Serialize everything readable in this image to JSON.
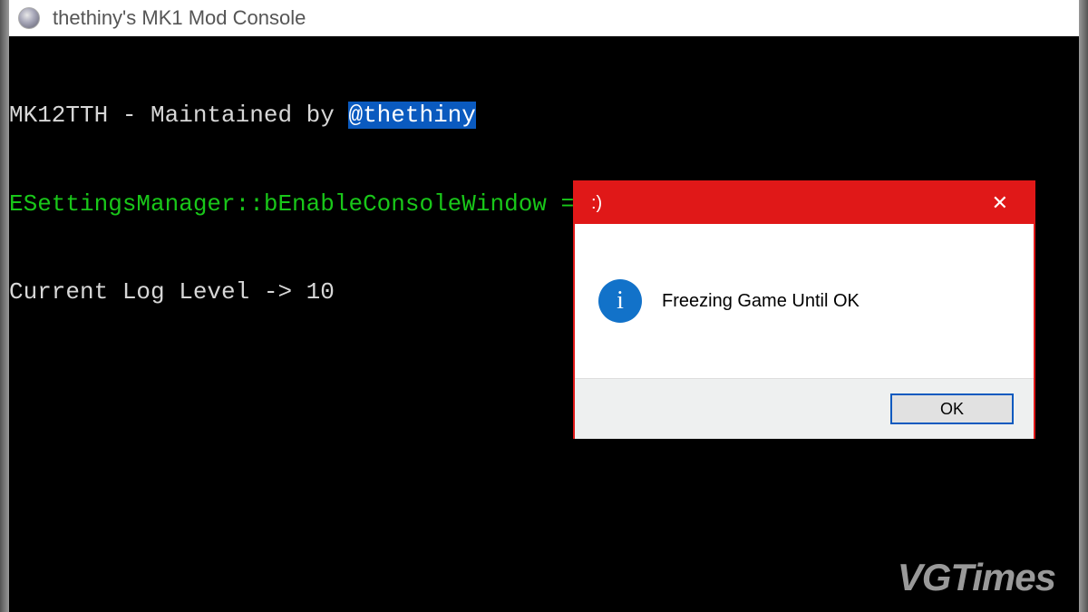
{
  "window": {
    "title": "thethiny's MK1 Mod Console"
  },
  "console": {
    "line1_prefix": "MK12TTH - Maintained by ",
    "line1_handle": "@thethiny",
    "line2": "ESettingsManager::bEnableConsoleWindow = true",
    "line3": "Current Log Level -> 10"
  },
  "dialog": {
    "title": ":)",
    "message": "Freezing Game Until OK",
    "ok_label": "OK",
    "close_glyph": "✕"
  },
  "info_icon": {
    "glyph": "i"
  },
  "watermark": "VGTimes"
}
